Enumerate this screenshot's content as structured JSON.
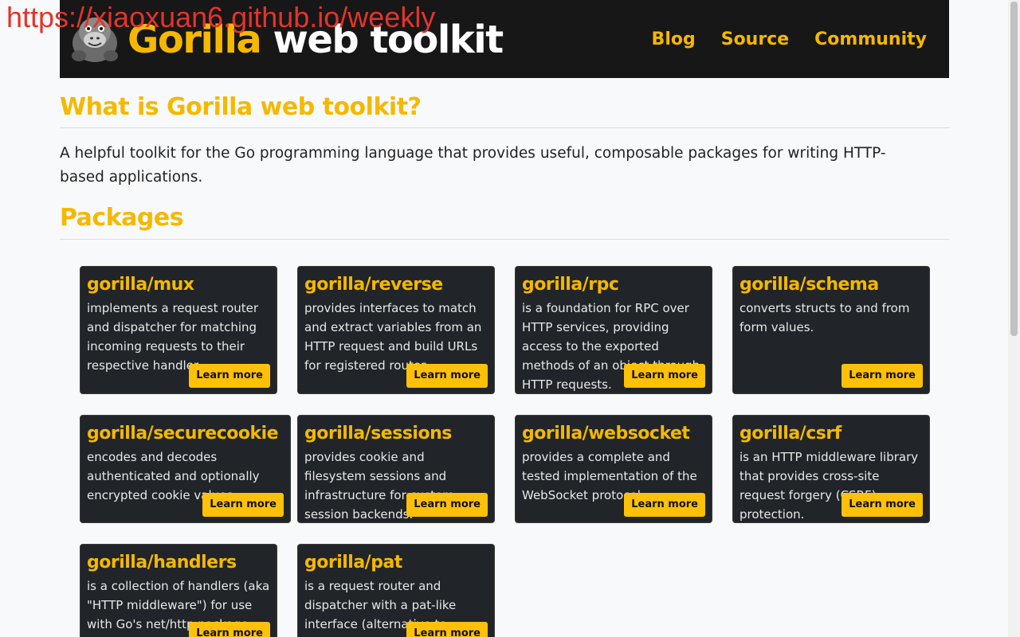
{
  "watermark": "https://xiaoxuan6.github.io/weekly",
  "header": {
    "brand_part1": "Gorilla",
    "brand_part2": "web toolkit",
    "logo_icon": "gorilla-logo-icon",
    "nav": [
      {
        "label": "Blog"
      },
      {
        "label": "Source"
      },
      {
        "label": "Community"
      }
    ]
  },
  "main": {
    "title": "What is Gorilla web toolkit?",
    "lead": "A helpful toolkit for the Go programming language that provides useful, composable packages for writing HTTP-based applications.",
    "packages_heading": "Packages",
    "learn_more_label": "Learn more",
    "packages": [
      {
        "name": "gorilla/mux",
        "desc": "implements a request router and dispatcher for matching incoming requests to their respective handler."
      },
      {
        "name": "gorilla/reverse",
        "desc": "provides interfaces to match and extract variables from an HTTP request and build URLs for registered routes."
      },
      {
        "name": "gorilla/rpc",
        "desc": "is a foundation for RPC over HTTP services, providing access to the exported methods of an object through HTTP requests."
      },
      {
        "name": "gorilla/schema",
        "desc": "converts structs to and from form values."
      },
      {
        "name": "gorilla/securecookie",
        "desc": "encodes and decodes authenticated and optionally encrypted cookie values."
      },
      {
        "name": "gorilla/sessions",
        "desc": "provides cookie and filesystem sessions and infrastructure for custom session backends."
      },
      {
        "name": "gorilla/websocket",
        "desc": "provides a complete and tested implementation of the WebSocket protocol."
      },
      {
        "name": "gorilla/csrf",
        "desc": "is an HTTP middleware library that provides cross-site request forgery (CSRF) protection."
      },
      {
        "name": "gorilla/handlers",
        "desc": "is a collection of handlers (aka \"HTTP middleware\") for use with Go's net/http package."
      },
      {
        "name": "gorilla/pat",
        "desc": "is a request router and dispatcher with a pat-like interface (alternative to gorilla/mux)."
      }
    ]
  },
  "colors": {
    "accent": "#f5b800",
    "button": "#ffc107",
    "header_bg": "#171717",
    "card_bg": "#212529"
  }
}
